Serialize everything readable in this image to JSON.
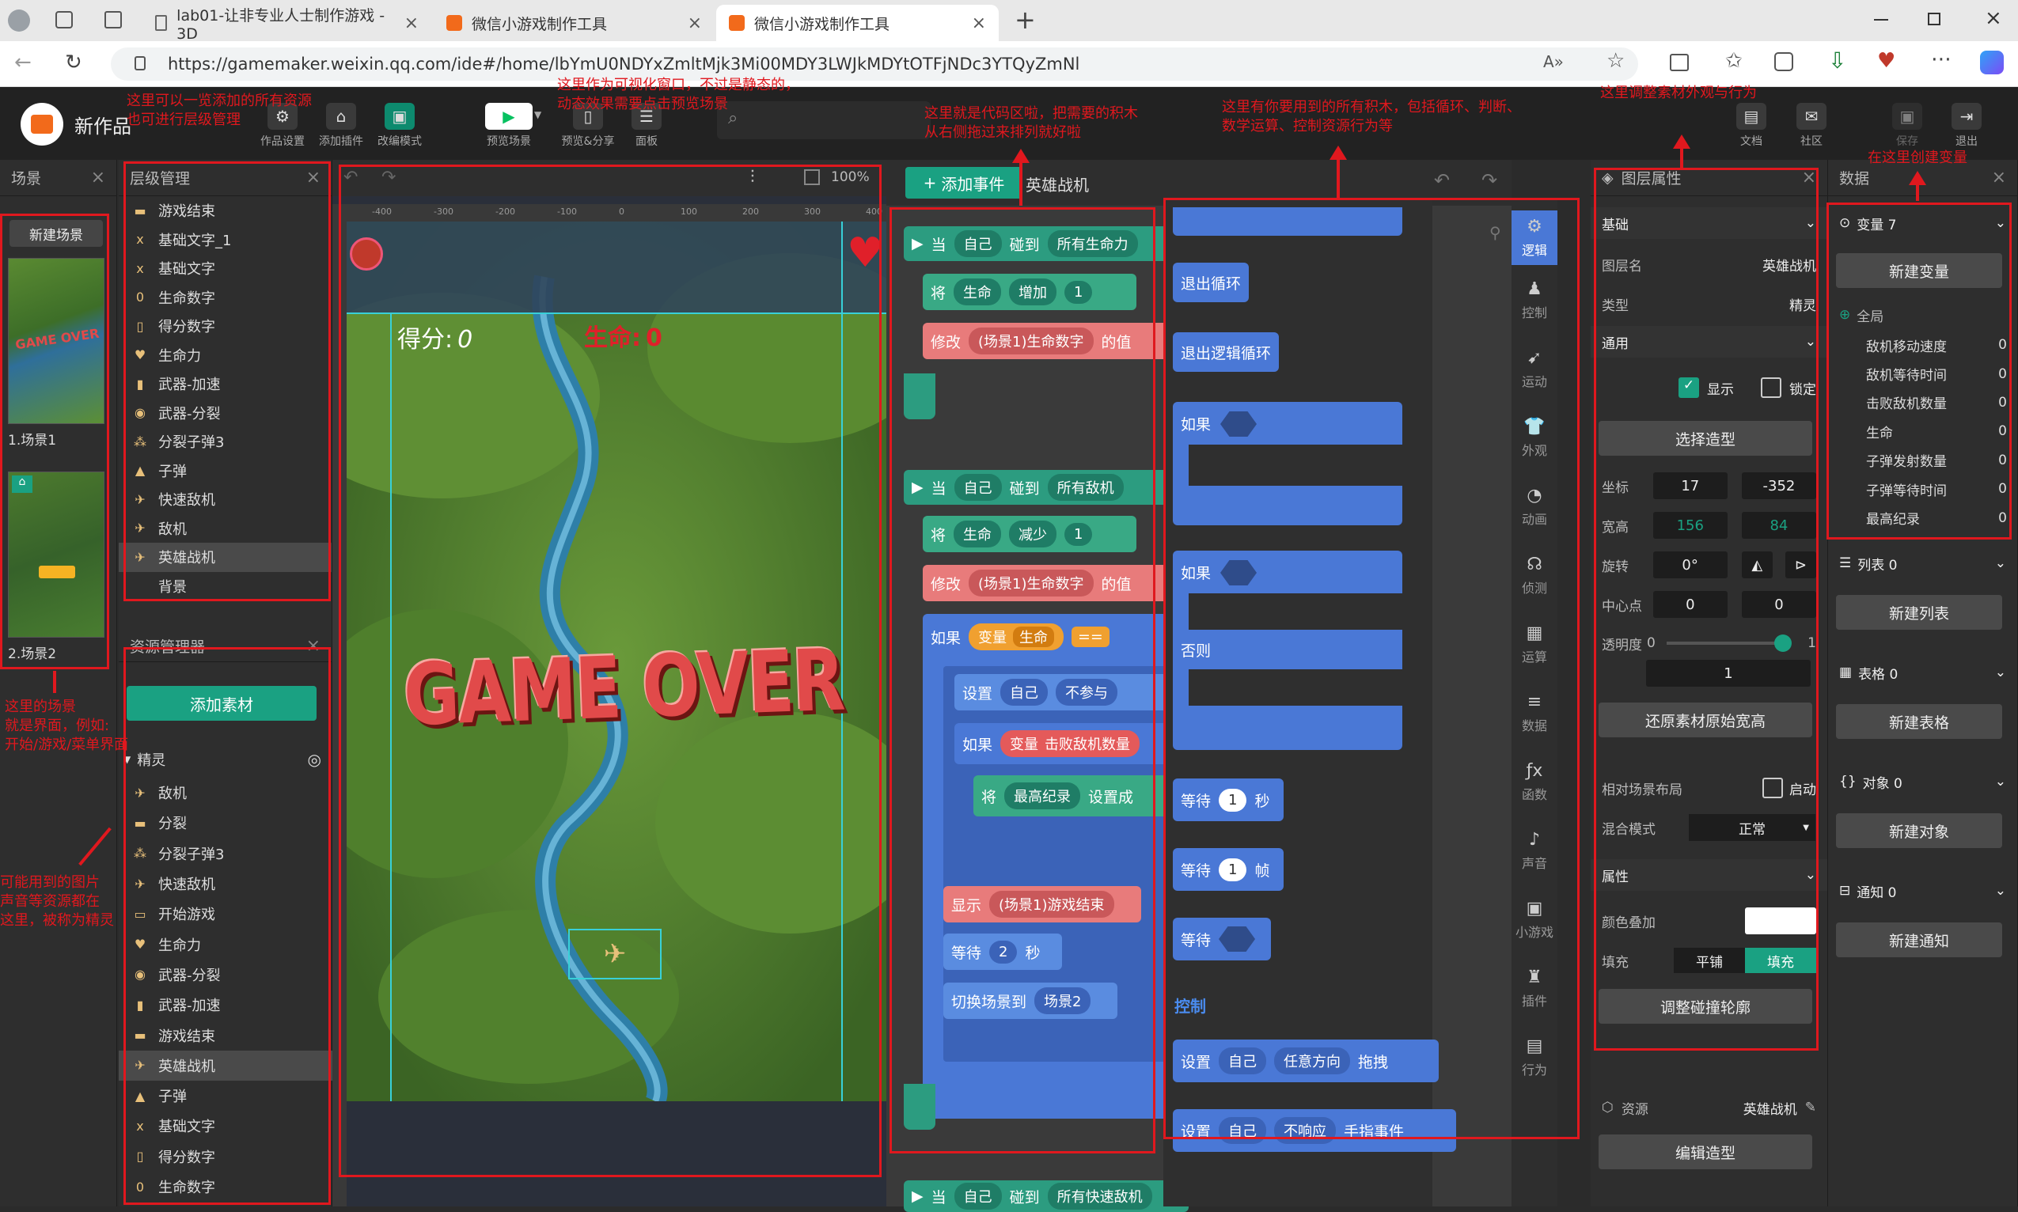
{
  "browser": {
    "tabs": [
      {
        "title": "lab01-让非专业人士制作游戏 - 3D"
      },
      {
        "title": "微信小游戏制作工具"
      },
      {
        "title": "微信小游戏制作工具"
      }
    ],
    "new_tab": "+",
    "url": "https://gamemaker.weixin.qq.com/ide#/home/lbYmU0NDYxZmltMjk3Mi00MDY3LWJkMDYtOTFjNDc3YTQyZmNl"
  },
  "toolbar": {
    "project_name": "新作品",
    "buttons": [
      "作品设置",
      "添加插件",
      "改编模式",
      "预览场景",
      "预览&分享",
      "面板"
    ],
    "right_buttons": [
      "文档",
      "社区",
      "保存",
      "退出"
    ]
  },
  "scene_panel": {
    "title": "场景",
    "new_scene": "新建场景",
    "scenes": [
      {
        "label": "1.场景1"
      },
      {
        "label": "2.场景2"
      }
    ]
  },
  "layer_panel": {
    "title": "层级管理",
    "items": [
      "游戏结束",
      "基础文字_1",
      "基础文字",
      "生命数字",
      "得分数字",
      "生命力",
      "武器-加速",
      "武器-分裂",
      "分裂子弹3",
      "子弹",
      "快速敌机",
      "敌机",
      "英雄战机",
      "背景"
    ],
    "selected": "英雄战机"
  },
  "asset_panel": {
    "title": "资源管理器",
    "add_button": "添加素材",
    "section": "精灵",
    "items": [
      "敌机",
      "分裂",
      "分裂子弹3",
      "快速敌机",
      "开始游戏",
      "生命力",
      "武器-分裂",
      "武器-加速",
      "游戏结束",
      "英雄战机",
      "子弹",
      "基础文字",
      "得分数字",
      "生命数字"
    ]
  },
  "canvas": {
    "zoom": "100%",
    "ruler_labels": [
      "-400",
      "-300",
      "-200",
      "-100",
      "0",
      "100",
      "200",
      "300",
      "400"
    ],
    "score_label": "得分:",
    "score_value": "0",
    "life_label": "生命:",
    "life_value": "0",
    "game_over": "GAME OVER"
  },
  "code_panel": {
    "add_event": "添加事件",
    "sprite_name": "英雄战机",
    "blocks": {
      "when1": [
        "当",
        "自己",
        "碰到",
        "所有生命力"
      ],
      "set1": [
        "将",
        "生命",
        "增加",
        "1"
      ],
      "modify1": [
        "修改",
        "(场景1)生命数字",
        "的值"
      ],
      "when2": [
        "当",
        "自己",
        "碰到",
        "所有敌机"
      ],
      "set2": [
        "将",
        "生命",
        "减少",
        "1"
      ],
      "modify2": [
        "修改",
        "(场景1)生命数字",
        "的值"
      ],
      "if1": [
        "如果",
        "变量",
        "生命",
        "=="
      ],
      "setself": [
        "设置",
        "自己",
        "不参与"
      ],
      "if2": [
        "如果",
        "变量",
        "击败敌机数量"
      ],
      "record": [
        "将",
        "最高纪录",
        "设置成"
      ],
      "show": [
        "显示",
        "(场景1)游戏结束"
      ],
      "wait": [
        "等待",
        "2",
        "秒"
      ],
      "switch": [
        "切换场景到",
        "场景2"
      ],
      "when3": [
        "当",
        "自己",
        "碰到",
        "所有快速敌机"
      ]
    }
  },
  "palette": {
    "blocks": [
      "退出循环",
      "退出逻辑循环",
      "如果",
      "如果",
      "否则",
      "等待",
      "1",
      "秒",
      "等待",
      "1",
      "帧",
      "等待",
      "控制",
      "设置",
      "自己",
      "任意方向",
      "拖拽",
      "设置",
      "自己",
      "不响应",
      "手指事件"
    ],
    "categories": [
      "逻辑",
      "控制",
      "运动",
      "外观",
      "动画",
      "侦测",
      "运算",
      "数据",
      "函数",
      "声音",
      "小游戏",
      "插件",
      "行为"
    ]
  },
  "props_panel": {
    "title": "图层属性",
    "sections": {
      "basic": "基础",
      "common": "通用",
      "attrs": "属性"
    },
    "layer_name_label": "图层名",
    "layer_name": "英雄战机",
    "type_label": "类型",
    "type": "精灵",
    "show_label": "显示",
    "lock_label": "锁定",
    "choose_shape": "选择造型",
    "coord_label": "坐标",
    "x": "17",
    "y": "-352",
    "size_label": "宽高",
    "width": "156",
    "height": "84",
    "rotate_label": "旋转",
    "rotate": "0°",
    "center_label": "中心点",
    "cx": "0",
    "cy": "0",
    "opacity_label": "透明度",
    "opacity_min": "0",
    "opacity_max": "1",
    "opacity": "1",
    "restore": "还原素材原始宽高",
    "relative_label": "相对场景布局",
    "enable_label": "启动",
    "blend_label": "混合模式",
    "blend": "正常",
    "color_label": "颜色叠加",
    "fill_label": "填充",
    "fill_tile": "平铺",
    "fill_fill": "填充",
    "collision": "调整碰撞轮廓",
    "resource_label": "资源",
    "resource": "英雄战机",
    "edit_shape": "编辑造型"
  },
  "data_panel": {
    "title": "数据",
    "variables_header": "变量 7",
    "new_variable": "新建变量",
    "global_label": "全局",
    "variables": [
      {
        "name": "敌机移动速度",
        "value": "0"
      },
      {
        "name": "敌机等待时间",
        "value": "0"
      },
      {
        "name": "击败敌机数量",
        "value": "0"
      },
      {
        "name": "生命",
        "value": "0"
      },
      {
        "name": "子弹发射数量",
        "value": "0"
      },
      {
        "name": "子弹等待时间",
        "value": "0"
      },
      {
        "name": "最高纪录",
        "value": "0"
      }
    ],
    "list_header": "列表 0",
    "new_list": "新建列表",
    "table_header": "表格 0",
    "new_table": "新建表格",
    "object_header": "对象 0",
    "new_object": "新建对象",
    "notify_header": "通知 0",
    "new_notify": "新建通知"
  },
  "annotations": [
    "这里可以一览添加的所有资源\n也可进行层级管理",
    "这里作为可视化窗口，不过是静态的，\n动态效果需要点击预览场景",
    "这里就是代码区啦，把需要的积木\n从右侧拖过来排列就好啦",
    "这里有你要用到的所有积木，包括循环、判断、\n数学运算、控制资源行为等",
    "这里调整素材外观与行为",
    "在这里创建变量",
    "这里的场景\n就是界面，例如:\n开始/游戏/菜单界面",
    "可能用到的图片\n声音等资源都在\n这里，被称为精灵"
  ]
}
